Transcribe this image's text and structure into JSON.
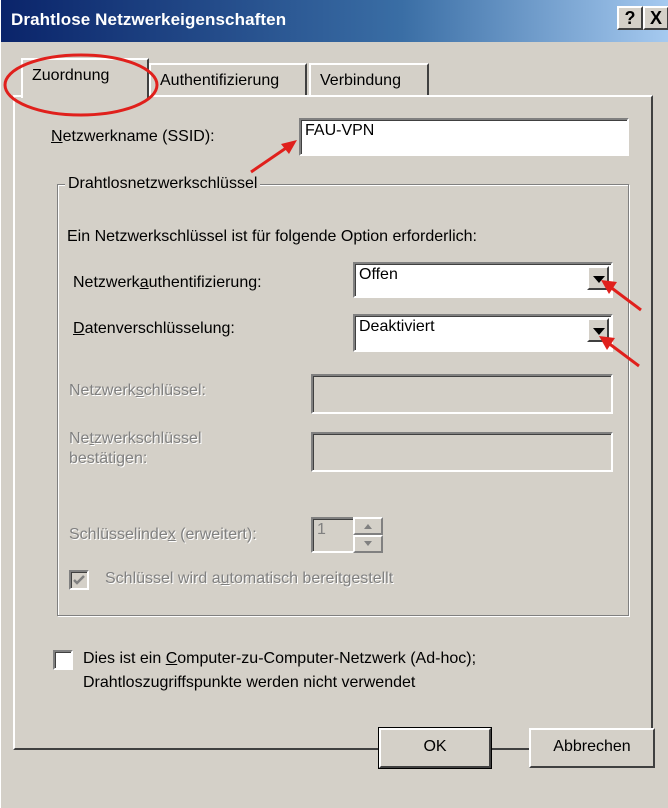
{
  "dialog": {
    "title": "Drahtlose Netzwerkeigenschaften",
    "help_label": "?",
    "close_label": "X"
  },
  "tabs": [
    {
      "label": "Zuordnung",
      "active": true
    },
    {
      "label": "Authentifizierung",
      "active": false
    },
    {
      "label": "Verbindung",
      "active": false
    }
  ],
  "ssid": {
    "label_pre": "N",
    "label_rest": "etzwerkname (SSID):",
    "value": "FAU-VPN"
  },
  "key_group": {
    "legend": "Drahtlosnetzwerkschlüssel",
    "info": "Ein Netzwerkschlüssel ist für folgende Option erforderlich:",
    "auth_label_pre": "Netzwerk",
    "auth_label_ul": "a",
    "auth_label_post": "uthentifizierung:",
    "auth_value": "Offen",
    "enc_label_ul": "D",
    "enc_label_post": "atenverschlüsselung:",
    "enc_value": "Deaktiviert",
    "key_label_pre": "Netzwerk",
    "key_label_ul": "s",
    "key_label_post": "chlüssel:",
    "confirm_label_line1_pre": "Ne",
    "confirm_label_line1_ul": "t",
    "confirm_label_line1_post": "zwerkschlüssel",
    "confirm_label_line2": "bestätigen:",
    "index_label_pre": "Schlüsselinde",
    "index_label_ul": "x",
    "index_label_post": " (erweitert):",
    "index_value": "1",
    "auto_key_pre": "Schlüssel wird a",
    "auto_key_ul": "u",
    "auto_key_post": "tomatisch bereitgestellt",
    "auto_key_checked": true
  },
  "adhoc": {
    "line1_pre": "Dies ist ein ",
    "line1_ul": "C",
    "line1_post": "omputer-zu-Computer-Netzwerk (Ad-hoc);",
    "line2": "Drahtloszugriffspunkte werden nicht verwendet",
    "checked": false
  },
  "buttons": {
    "ok": "OK",
    "cancel": "Abbrechen"
  },
  "colors": {
    "annotation": "#e0201c",
    "title_bar": "#0a246a",
    "face": "#d4d0c8"
  }
}
